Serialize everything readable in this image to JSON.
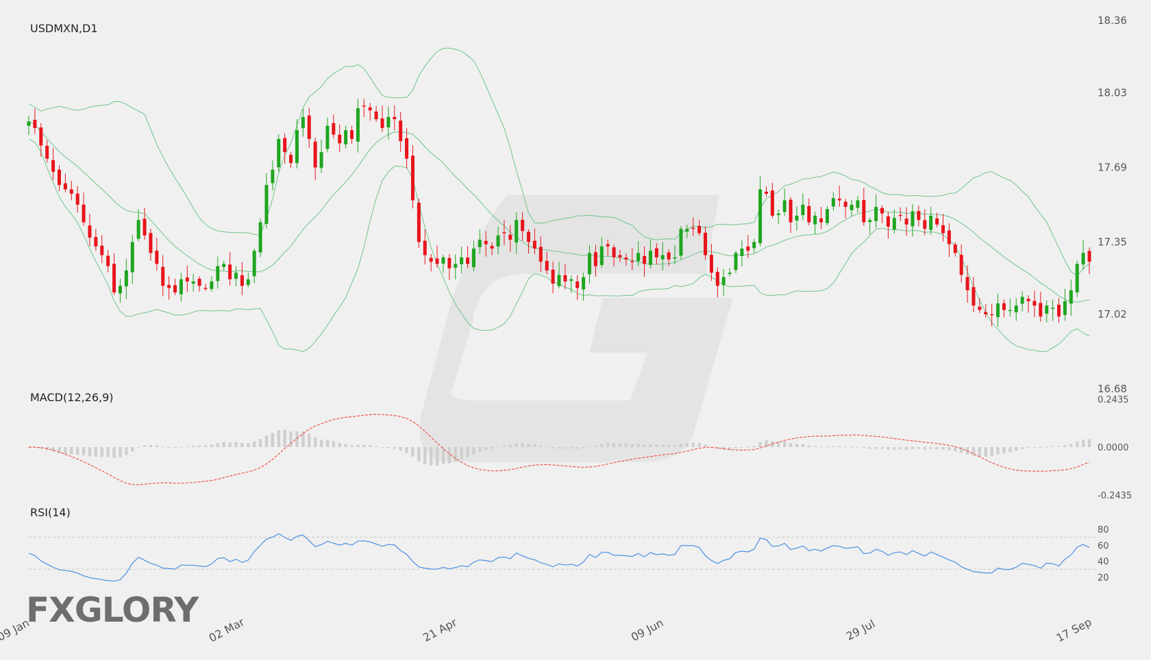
{
  "chart_data": {
    "type": "candlestick",
    "title": "USDMXN,D1",
    "price_axis": {
      "range": [
        16.68,
        18.36
      ],
      "ticks": [
        "18.36",
        "18.03",
        "17.69",
        "17.35",
        "17.02",
        "16.68"
      ]
    },
    "x_labels": [
      "09 Jan",
      "02 Mar",
      "21 Apr",
      "09 Jun",
      "29 Jul",
      "17 Sep"
    ],
    "candle_count": 171,
    "close_prices": [
      17.9,
      17.87,
      17.79,
      17.73,
      17.67,
      17.61,
      17.59,
      17.57,
      17.52,
      17.44,
      17.37,
      17.33,
      17.29,
      17.24,
      17.12,
      17.15,
      17.22,
      17.35,
      17.45,
      17.38,
      17.3,
      17.25,
      17.15,
      17.14,
      17.12,
      17.18,
      17.17,
      17.17,
      17.15,
      17.14,
      17.17,
      17.24,
      17.25,
      17.18,
      17.21,
      17.15,
      17.18,
      17.31,
      17.44,
      17.61,
      17.68,
      17.82,
      17.76,
      17.71,
      17.86,
      17.92,
      17.82,
      17.69,
      17.76,
      17.88,
      17.84,
      17.8,
      17.86,
      17.82,
      17.96,
      17.97,
      17.95,
      17.91,
      17.87,
      17.92,
      17.91,
      17.81,
      17.73,
      17.54,
      17.35,
      17.29,
      17.26,
      17.25,
      17.28,
      17.23,
      17.25,
      17.28,
      17.25,
      17.32,
      17.36,
      17.34,
      17.32,
      17.38,
      17.39,
      17.36,
      17.45,
      17.4,
      17.35,
      17.32,
      17.26,
      17.22,
      17.16,
      17.2,
      17.17,
      17.18,
      17.14,
      17.19,
      17.3,
      17.24,
      17.33,
      17.33,
      17.28,
      17.28,
      17.27,
      17.26,
      17.3,
      17.25,
      17.31,
      17.28,
      17.29,
      17.27,
      17.28,
      17.41,
      17.41,
      17.41,
      17.39,
      17.29,
      17.21,
      17.15,
      17.19,
      17.21,
      17.3,
      17.32,
      17.31,
      17.35,
      17.59,
      17.57,
      17.47,
      17.48,
      17.54,
      17.44,
      17.47,
      17.52,
      17.44,
      17.47,
      17.44,
      17.5,
      17.55,
      17.54,
      17.51,
      17.52,
      17.54,
      17.44,
      17.45,
      17.51,
      17.48,
      17.42,
      17.46,
      17.47,
      17.43,
      17.49,
      17.45,
      17.41,
      17.47,
      17.43,
      17.39,
      17.34,
      17.3,
      17.2,
      17.13,
      17.06,
      17.04,
      17.02,
      17.02,
      17.07,
      17.04,
      17.04,
      17.06,
      17.1,
      17.08,
      17.06,
      17.01,
      17.06,
      17.05,
      17.01,
      17.08,
      17.13,
      17.25,
      17.3,
      17.26
    ],
    "indicators": {
      "bollinger_bands": {
        "color": "#6fc48a"
      },
      "macd": {
        "label": "MACD(12,26,9)",
        "axis_ticks": [
          "0.2435",
          "0.0000",
          "-0.2435"
        ],
        "range": [
          -0.2435,
          0.2435
        ],
        "histogram_color": "#cfcfcf",
        "signal_color": "#f2524a"
      },
      "rsi": {
        "label": "RSI(14)",
        "axis_ticks": [
          "80",
          "60",
          "40",
          "20"
        ],
        "levels": [
          70,
          30
        ],
        "line_color": "#4a90e2"
      }
    },
    "colors": {
      "up": "#1fa51f",
      "down": "#e8141b",
      "background": "#f0f0f0"
    }
  },
  "branding": {
    "logo_text": "FXGLORY"
  }
}
